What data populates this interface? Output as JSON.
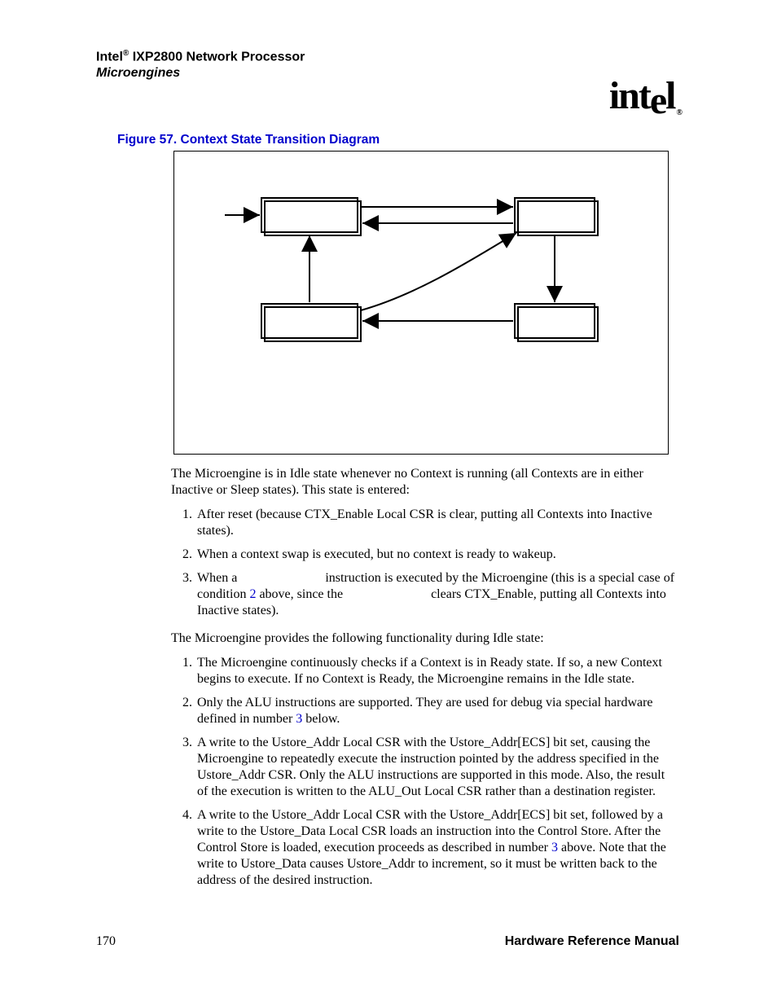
{
  "header": {
    "line1_prefix": "Intel",
    "line1_reg": "®",
    "line1_suffix": " IXP2800 Network Processor",
    "line2": "Microengines"
  },
  "logo": {
    "text": "int",
    "text2": "e",
    "text3": "l",
    "reg": "®"
  },
  "figure": {
    "caption": "Figure 57. Context State Transition Diagram"
  },
  "body": {
    "para1": "The Microengine is in Idle state whenever no Context is running (all Contexts are in either Inactive or Sleep states). This state is entered:",
    "list1": {
      "i1": "After reset (because CTX_Enable Local CSR is clear, putting all Contexts into Inactive states).",
      "i2": "When a context swap is executed, but no context is ready to wakeup.",
      "i3_a": "When a ",
      "i3_b": " instruction is executed by the Microengine (this is a special case of condition ",
      "i3_ref": "2",
      "i3_c": " above, since the ",
      "i3_d": " clears CTX_Enable, putting all Contexts into Inactive states)."
    },
    "para2": "The Microengine provides the following functionality during Idle state:",
    "list2": {
      "i1": "The Microengine continuously checks if a Context is in Ready state. If so, a new Context begins to execute. If no Context is Ready, the Microengine remains in the Idle state.",
      "i2_a": "Only the ALU instructions are supported. They are used for debug via special hardware defined in number ",
      "i2_ref": "3",
      "i2_b": " below.",
      "i3": "A write to the Ustore_Addr Local CSR with the Ustore_Addr[ECS] bit set, causing the Microengine to repeatedly execute the instruction pointed by the address specified in the Ustore_Addr CSR. Only the ALU instructions are supported in this mode. Also, the result of the execution is written to the ALU_Out Local CSR rather than a destination register.",
      "i4_a": "A write to the Ustore_Addr Local CSR with the Ustore_Addr[ECS] bit set, followed by a write to the Ustore_Data Local CSR loads an instruction into the Control Store. After the Control Store is loaded, execution proceeds as described in number ",
      "i4_ref": "3",
      "i4_b": " above. Note that the write to Ustore_Data causes Ustore_Addr to increment, so it must be written back to the address of the desired instruction."
    }
  },
  "footer": {
    "page": "170",
    "doc": "Hardware Reference Manual"
  }
}
